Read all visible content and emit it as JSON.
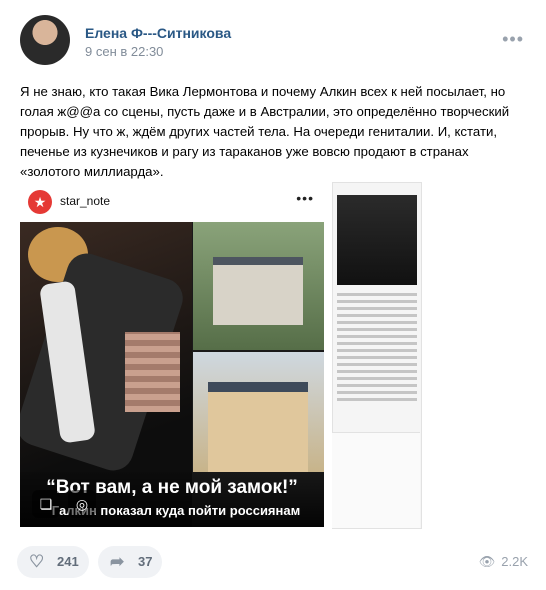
{
  "post": {
    "author": "Елена Ф---Ситникова",
    "date": "9 сен в 22:30",
    "menu_icon": "more-horizontal-icon",
    "text": "Я не знаю, кто такая Вика Лермонтова и почему Алкин всех к ней посылает, но голая ж@@а со сцены, пусть даже и в Австралии, это определённо творческий прорыв. Ну что ж, ждём других частей тела. На очереди гениталии. И, кстати, печенье из кузнечиков и рагу из тараканов уже вовсю продают в странах «золотого миллиарда»."
  },
  "embed": {
    "logo": "★",
    "handle": "star_note",
    "menu": "•••",
    "caption_main": "“Вот вам, а не мой замок!”",
    "caption_sub": "Галкин показал куда пойти россиянам",
    "save_icon": "bookmark-icon",
    "lens_icon": "lens-icon"
  },
  "footer": {
    "likes": "241",
    "shares": "37",
    "views": "2.2K",
    "like_icon": "heart-icon",
    "share_icon": "share-icon",
    "views_icon": "eye-icon"
  },
  "colors": {
    "author": "#2a5885",
    "meta": "#818c99",
    "pill_bg": "#f0f2f5",
    "logo_red": "#e53935"
  }
}
